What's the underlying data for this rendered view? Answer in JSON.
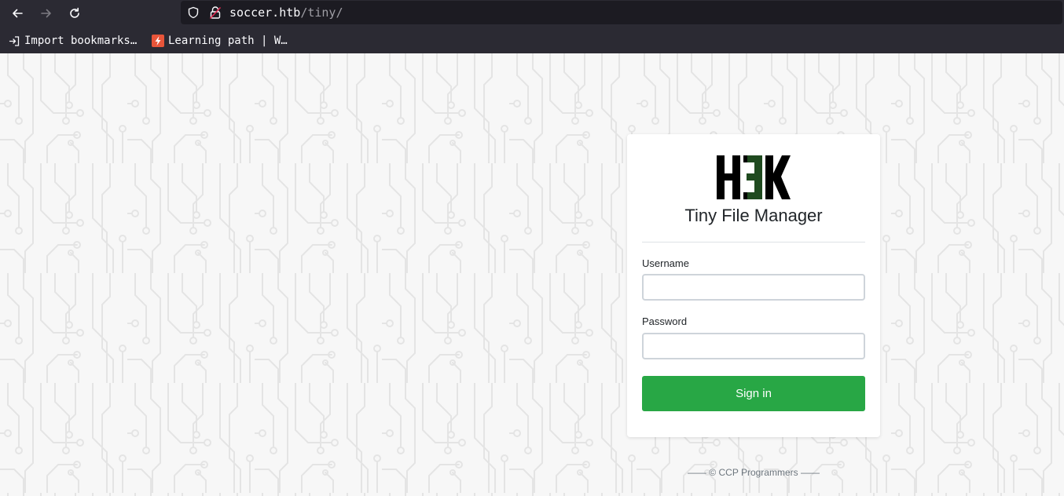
{
  "browser": {
    "url_host": "soccer.htb",
    "url_path": "/tiny/",
    "bookmarks": [
      {
        "label": "Import bookmarks…",
        "icon": "import-icon"
      },
      {
        "label": "Learning path | W…",
        "icon": "lightning-icon"
      }
    ]
  },
  "login": {
    "logo_text": "H3K",
    "app_title": "Tiny File Manager",
    "username_label": "Username",
    "username_value": "",
    "password_label": "Password",
    "password_value": "",
    "sign_in_label": "Sign in"
  },
  "footer": {
    "text": "—— © CCP Programmers ——"
  },
  "colors": {
    "chrome_bg": "#2b2a33",
    "url_bar_bg": "#1c1b22",
    "page_bg": "#f7f7f7",
    "sign_in_bg": "#28a745",
    "logo_accent": "#1f4a1f"
  }
}
